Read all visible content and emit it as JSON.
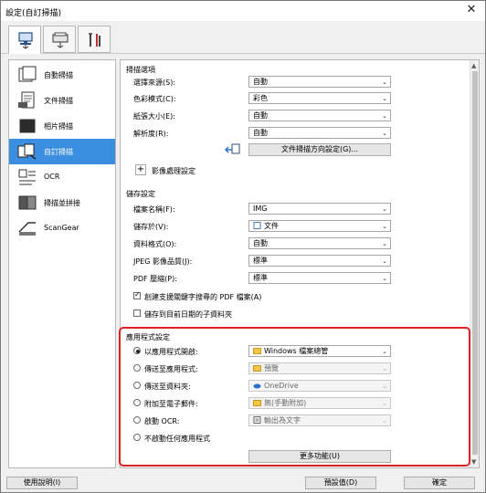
{
  "window": {
    "title": "設定(自訂掃描)",
    "close_glyph": "✕"
  },
  "top_tabs": [
    {
      "name": "scan-from-computer",
      "icon": "computer-scanner-icon"
    },
    {
      "name": "scan-from-panel",
      "icon": "scanner-panel-icon"
    },
    {
      "name": "general-settings",
      "icon": "tools-icon"
    }
  ],
  "sidebar": {
    "items": [
      {
        "label": "自動掃描",
        "icon": "auto-scan-icon",
        "active": false
      },
      {
        "label": "文件掃描",
        "icon": "document-scan-icon",
        "active": false
      },
      {
        "label": "相片掃描",
        "icon": "photo-scan-icon",
        "active": false
      },
      {
        "label": "自訂掃描",
        "icon": "custom-scan-icon",
        "active": true
      },
      {
        "label": "OCR",
        "icon": "ocr-icon",
        "active": false
      },
      {
        "label": "掃描並拼接",
        "icon": "stitch-icon",
        "active": false
      },
      {
        "label": "ScanGear",
        "icon": "scangear-icon",
        "active": false
      }
    ]
  },
  "scan_options": {
    "title": "掃描選項",
    "rows": [
      {
        "label": "選擇來源(S):",
        "value": "自動"
      },
      {
        "label": "色彩模式(C):",
        "value": "彩色"
      },
      {
        "label": "紙張大小(E):",
        "value": "自動"
      },
      {
        "label": "解析度(R):",
        "value": "自動"
      }
    ],
    "orientation_button": "文件掃描方向設定(G)...",
    "image_processing": "影像處理設定"
  },
  "save_settings": {
    "title": "儲存設定",
    "rows": [
      {
        "label": "檔案名稱(F):",
        "value": "IMG"
      },
      {
        "label": "儲存於(V):",
        "value": "文件"
      },
      {
        "label": "資料格式(O):",
        "value": "自動"
      },
      {
        "label": "JPEG 影像品質(J):",
        "value": "標準"
      },
      {
        "label": "PDF 壓縮(P):",
        "value": "標準"
      }
    ],
    "checkbox_keyword": "創建支援關鍵字搜尋的 PDF 檔案(A)",
    "checkbox_subfolder": "儲存到目前日期的子資料夾"
  },
  "app_settings": {
    "title": "應用程式設定",
    "rows": [
      {
        "label": "以應用程式開啟:",
        "value": "Windows 檔案總管",
        "checked": true,
        "disabled": false
      },
      {
        "label": "傳送至應用程式:",
        "value": "預覽",
        "checked": false,
        "disabled": true
      },
      {
        "label": "傳送至資料夾:",
        "value": "OneDrive",
        "checked": false,
        "disabled": true
      },
      {
        "label": "附加至電子郵件:",
        "value": "無(手動附加)",
        "checked": false,
        "disabled": true
      },
      {
        "label": "啟動 OCR:",
        "value": "輸出為文字",
        "checked": false,
        "disabled": true
      },
      {
        "label": "不啟動任何應用程式",
        "checked": false
      }
    ],
    "more_button": "更多功能(U)"
  },
  "footer": {
    "help": "使用說明(I)",
    "defaults": "預設值(D)",
    "ok": "確定"
  }
}
